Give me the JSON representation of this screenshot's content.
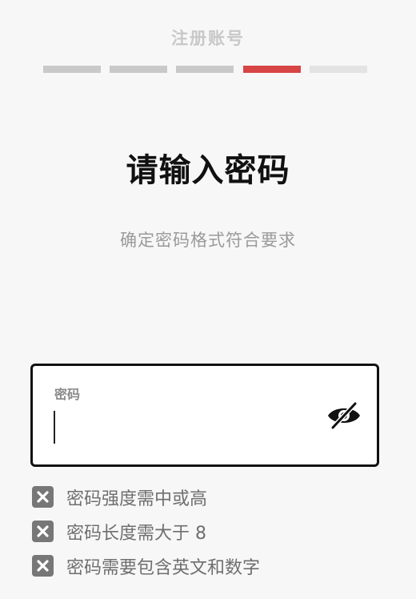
{
  "header": {
    "title": "注册账号"
  },
  "progress": {
    "total_steps": 5,
    "current_step": 4
  },
  "main": {
    "title": "请输入密码",
    "subtitle": "确定密码格式符合要求"
  },
  "password_field": {
    "label": "密码",
    "value": "",
    "visibility_icon": "eye-off-icon"
  },
  "requirements": [
    {
      "text": "密码强度需中或高",
      "status": "unmet",
      "icon": "x-icon"
    },
    {
      "text": "密码长度需大于 8",
      "status": "unmet",
      "icon": "x-icon"
    },
    {
      "text": "密码需要包含英文和数字",
      "status": "unmet",
      "icon": "x-icon"
    }
  ],
  "colors": {
    "background": "#f7f7f7",
    "accent": "#d84545",
    "step_done": "#c9c9c9",
    "step_todo": "#e3e3e3",
    "icon_unmet": "#777777",
    "field_border": "#111111"
  }
}
